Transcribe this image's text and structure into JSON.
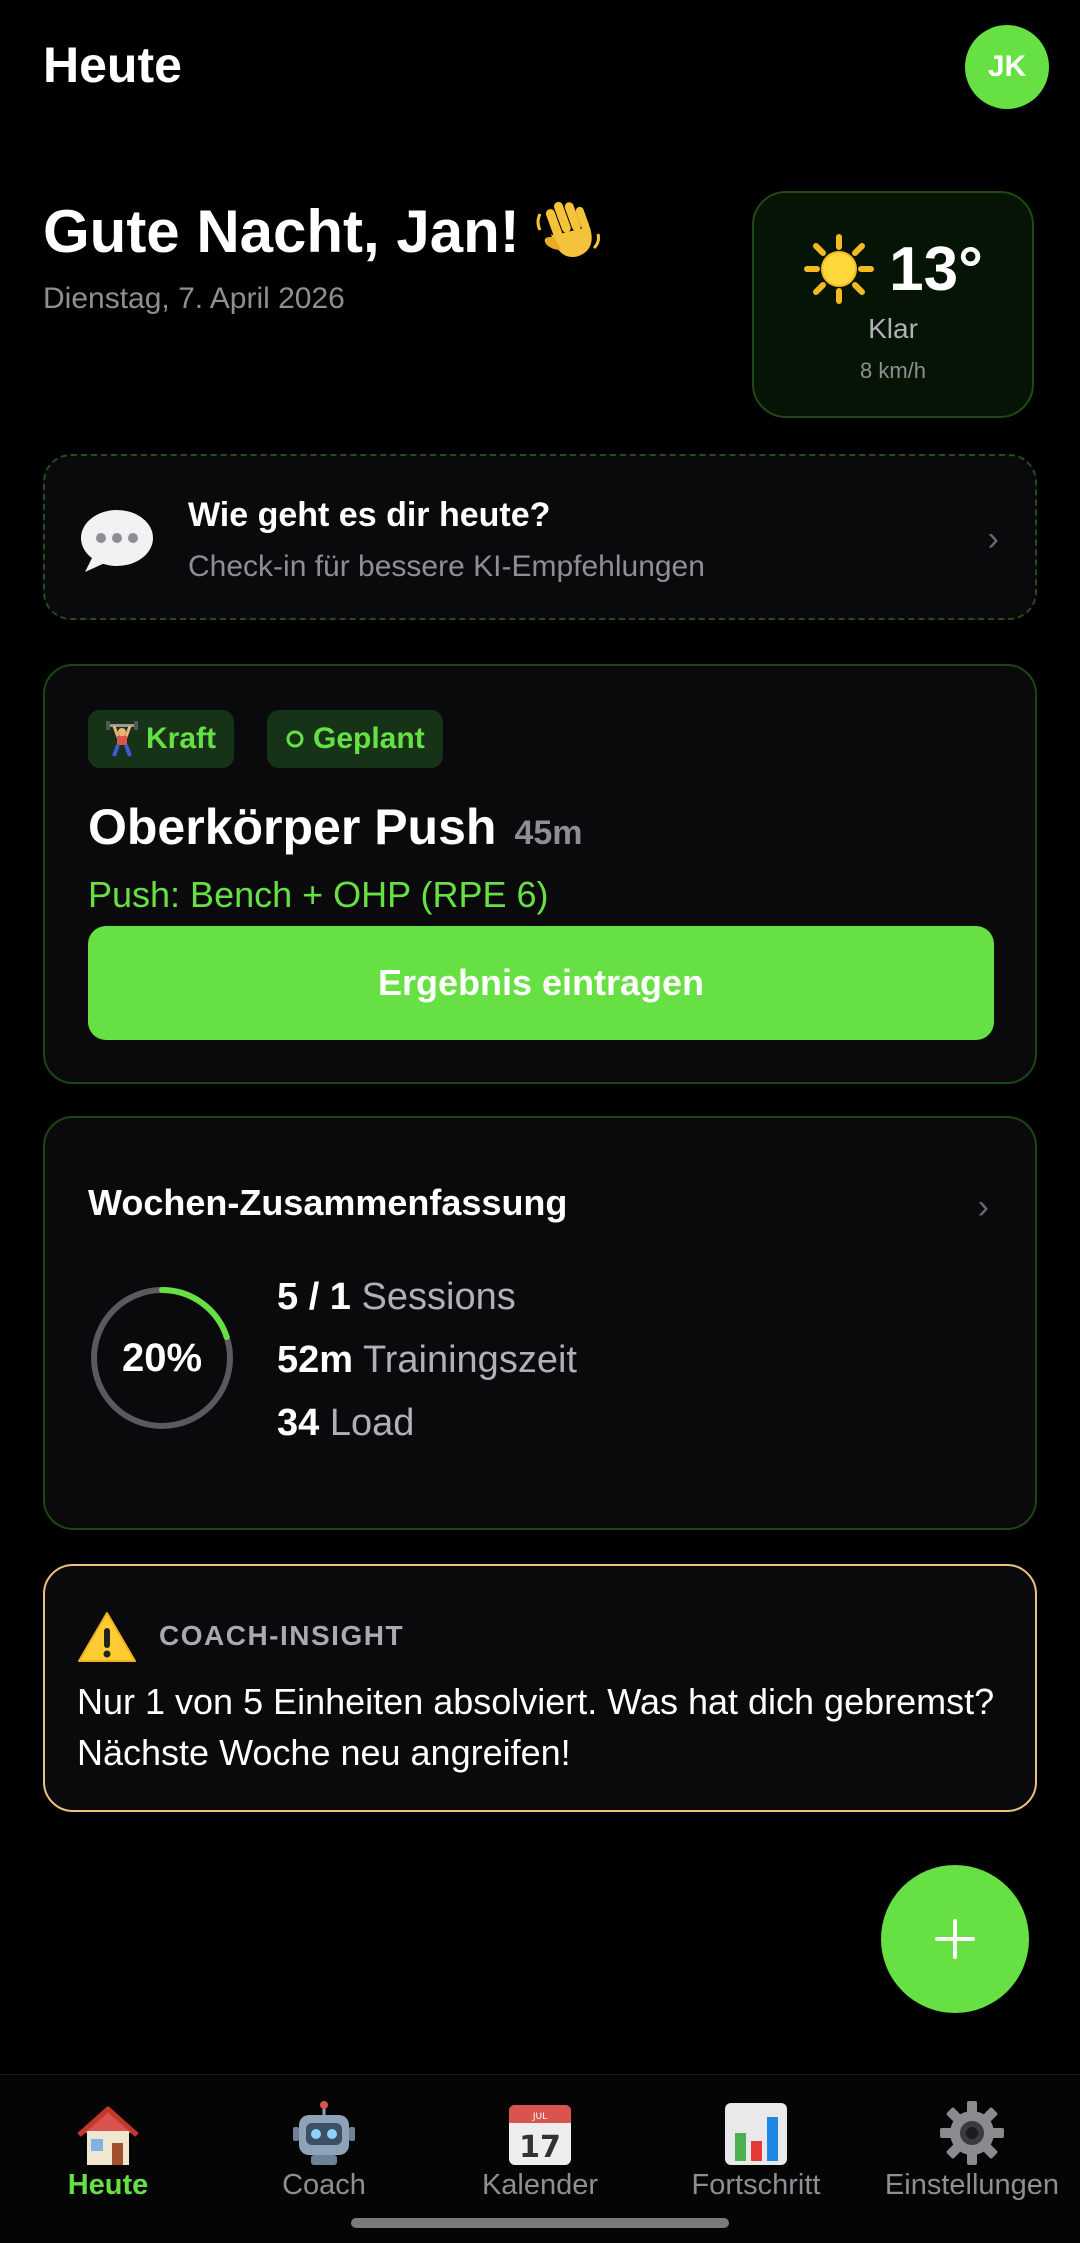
{
  "header": {
    "title": "Heute",
    "avatar_initials": "JK"
  },
  "greeting": {
    "text": "Gute Nacht, Jan!",
    "date": "Dienstag, 7. April 2026"
  },
  "weather": {
    "temperature": "13°",
    "condition": "Klar",
    "wind": "8 km/h",
    "icon": "sun-icon"
  },
  "checkin": {
    "title": "Wie geht es dir heute?",
    "subtitle": "Check-in für bessere KI-Empfehlungen"
  },
  "workout": {
    "tags": [
      {
        "icon": "weightlifter-icon",
        "label": "Kraft"
      },
      {
        "icon": "circle-outline-icon",
        "label": "Geplant"
      }
    ],
    "title": "Oberkörper Push",
    "duration": "45m",
    "description": "Push: Bench + OHP (RPE 6)",
    "button_label": "Ergebnis eintragen"
  },
  "summary": {
    "title": "Wochen-Zusammenfassung",
    "progress_label": "20%",
    "progress_fraction": 0.2,
    "stats": [
      {
        "value": "5 / 1",
        "label": "Sessions"
      },
      {
        "value": "52m",
        "label": "Trainingszeit"
      },
      {
        "value": "34",
        "label": "Load"
      }
    ]
  },
  "insight": {
    "label": "COACH-INSIGHT",
    "message": "Nur 1 von 5 Einheiten absolviert. Was hat dich gebremst? Nächste Woche neu angreifen!"
  },
  "tabs": [
    {
      "label": "Heute",
      "icon": "house-icon",
      "active": true
    },
    {
      "label": "Coach",
      "icon": "robot-icon",
      "active": false
    },
    {
      "label": "Kalender",
      "icon": "calendar-icon",
      "calendar_month": "JUL",
      "calendar_day": "17",
      "active": false
    },
    {
      "label": "Fortschritt",
      "icon": "bar-chart-icon",
      "active": false
    },
    {
      "label": "Einstellungen",
      "icon": "gear-icon",
      "active": false
    }
  ],
  "colors": {
    "accent": "#67e044",
    "background": "#000000",
    "card": "#0a0a0c",
    "warning_border": "#e8c27a"
  }
}
